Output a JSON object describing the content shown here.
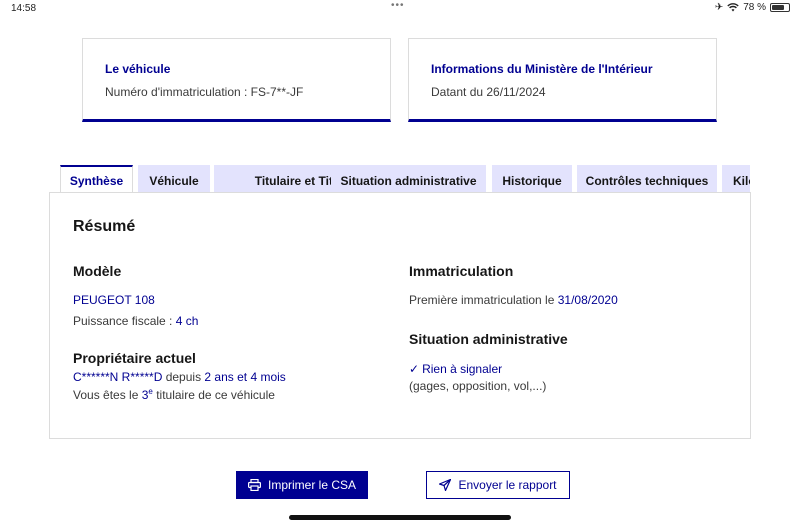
{
  "status_bar": {
    "time": "14:58",
    "battery": "78 %",
    "battery_level": 0.78
  },
  "cards": {
    "vehicle": {
      "title": "Le véhicule",
      "text": "Numéro d'immatriculation : FS-7**-JF"
    },
    "ministry": {
      "title": "Informations du Ministère de l'Intérieur",
      "text": "Datant du 26/11/2024"
    }
  },
  "tabs": [
    "Synthèse",
    "Véhicule",
    "Titulaire et Titre",
    "Situation administrative",
    "Historique",
    "Contrôles techniques",
    "Kilo"
  ],
  "summary": {
    "title": "Résumé",
    "model": {
      "heading": "Modèle",
      "name": "PEUGEOT 108",
      "power_label": "Puissance fiscale : ",
      "power_value": "4 ch"
    },
    "owner": {
      "heading": "Propriétaire actuel",
      "name": "C******N R*****D",
      "since_label": " depuis ",
      "since_value": "2 ans et 4 mois",
      "rank_prefix": "Vous êtes le ",
      "rank_number": "3",
      "rank_suffix_sup": "e",
      "rank_suffix": " titulaire de ce véhicule"
    },
    "registration": {
      "heading": "Immatriculation",
      "label": "Première immatriculation le ",
      "date": "31/08/2020"
    },
    "admin": {
      "heading": "Situation administrative",
      "status": "Rien à signaler",
      "note": "(gages, opposition, vol,...)"
    }
  },
  "buttons": {
    "print": "Imprimer le CSA",
    "send": "Envoyer le rapport"
  }
}
